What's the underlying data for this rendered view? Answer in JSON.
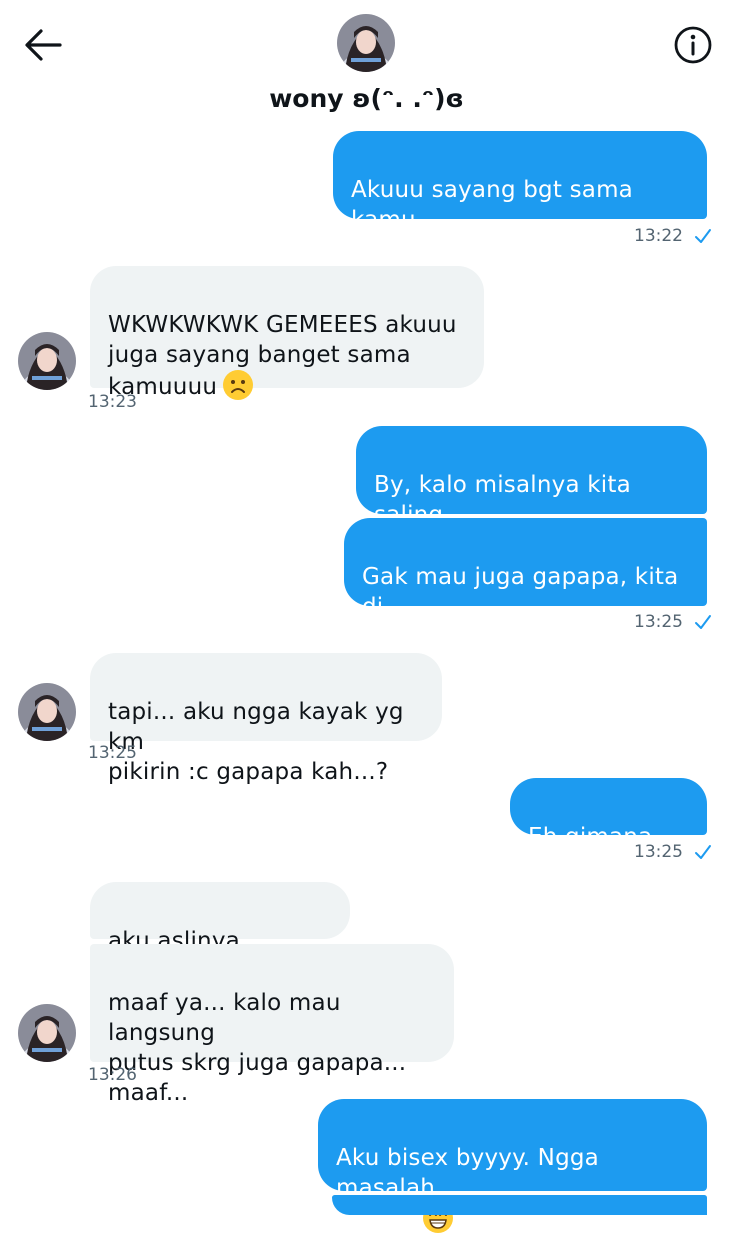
{
  "header": {
    "contact_name": "wony ʚ(ᵔ. .ᵔ)ɞ",
    "back_icon": "arrow-left-icon",
    "info_icon": "info-circle-icon"
  },
  "colors": {
    "outgoing_bubble": "#1d9bf0",
    "incoming_bubble": "#eff3f4",
    "timestamp": "#536471",
    "read_check": "#1d9bf0"
  },
  "messages": [
    {
      "id": "m1",
      "direction": "outgoing",
      "text": "Akuuu sayang bgt sama kamu\nlohhhh"
    },
    {
      "id": "m2",
      "direction": "incoming",
      "text": "WKWKWKWK GEMEEES akuuu\njuga sayang banget sama\nkamuuuu",
      "emoji": "frowning-face-emoji"
    },
    {
      "id": "m3",
      "direction": "outgoing",
      "text": "By, kalo misalnya kita saling\ntukeran rl kamu mau gak?"
    },
    {
      "id": "m4",
      "direction": "outgoing",
      "text": "Gak mau juga gapapa, kita di\nsini aja"
    },
    {
      "id": "m5",
      "direction": "incoming",
      "text": "tapi... aku ngga kayak yg km\npikirin :c gapapa kah...?"
    },
    {
      "id": "m6",
      "direction": "outgoing",
      "text": "Eh gimana by?"
    },
    {
      "id": "m7",
      "direction": "incoming",
      "text": "aku aslinya cowok..."
    },
    {
      "id": "m8",
      "direction": "incoming",
      "text": "maaf ya... kalo mau langsung\nputus skrg juga gapapa...\nmaaf..."
    },
    {
      "id": "m9",
      "direction": "outgoing",
      "text": "Aku bisex byyyy. Ngga masalah\nbuatku",
      "emoji": "grinning-face-emoji"
    }
  ],
  "timestamps": {
    "t1": "13:22",
    "t2": "13:23",
    "t3": "13:25",
    "t4": "13:25",
    "t5": "13:25",
    "t6": "13:26"
  }
}
